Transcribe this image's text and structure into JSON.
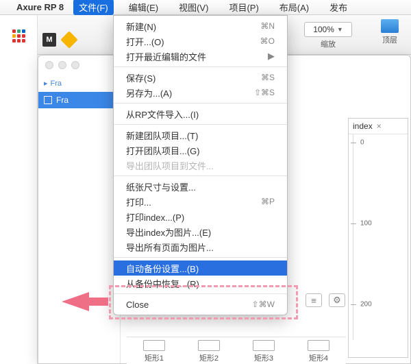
{
  "menubar": {
    "app": "Axure RP 8",
    "items": [
      "文件(F)",
      "编辑(E)",
      "视图(V)",
      "项目(P)",
      "布局(A)",
      "发布"
    ]
  },
  "zoom": {
    "value": "100%",
    "label": "缩放"
  },
  "topicon_label": "顶层",
  "fontweight": "Bold",
  "tree": {
    "crumb": "Fra",
    "selected": "Fra"
  },
  "panel": {
    "tab": "index",
    "ticks": [
      "0",
      "100",
      "200"
    ]
  },
  "menu": {
    "items": [
      {
        "label": "新建(N)",
        "sc": "⌘N"
      },
      {
        "label": "打开...(O)",
        "sc": "⌘O"
      },
      {
        "label": "打开最近编辑的文件",
        "sub": true
      },
      "sep",
      {
        "label": "保存(S)",
        "sc": "⌘S"
      },
      {
        "label": "另存为...(A)",
        "sc": "⇧⌘S"
      },
      "sep",
      {
        "label": "从RP文件导入...(I)"
      },
      "sep",
      {
        "label": "新建团队项目...(T)"
      },
      {
        "label": "打开团队项目...(G)"
      },
      {
        "label": "导出团队项目到文件...",
        "dis": true
      },
      "sep",
      {
        "label": "纸张尺寸与设置..."
      },
      {
        "label": "打印...",
        "sc": "⌘P"
      },
      {
        "label": "打印index...(P)"
      },
      {
        "label": "导出index为图片...(E)"
      },
      {
        "label": "导出所有页面为图片..."
      },
      "sep",
      {
        "label": "自动备份设置...(B)",
        "hl": true
      },
      {
        "label": "从备份中恢复...(R)"
      },
      "sep",
      {
        "label": "Close",
        "sc": "⇧⌘W"
      }
    ]
  },
  "shapes": [
    "矩形1",
    "矩形2",
    "矩形3",
    "矩形4"
  ]
}
